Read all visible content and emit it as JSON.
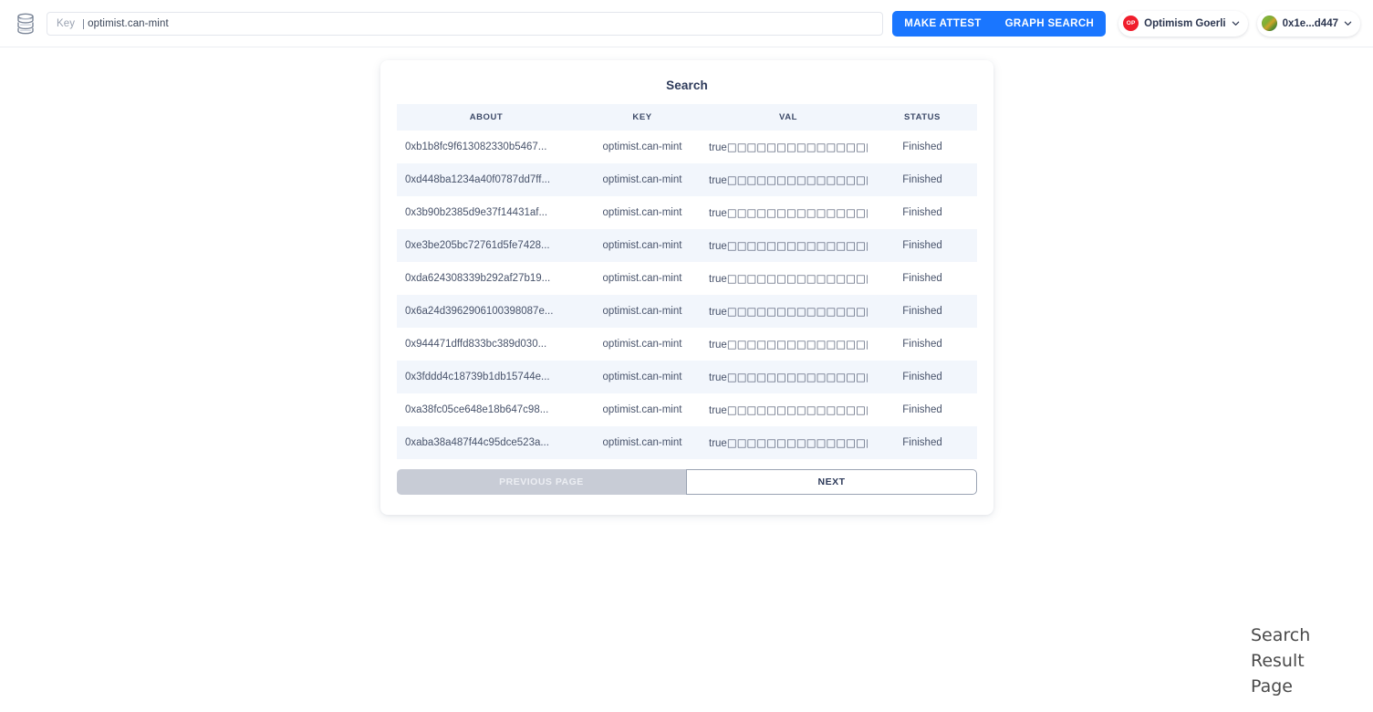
{
  "topbar": {
    "logo_icon": "database-icon",
    "search": {
      "label": "Key",
      "value": "optimist.can-mint",
      "placeholder": "Key"
    },
    "actions": {
      "make_attest": "MAKE ATTEST",
      "graph_search": "GRAPH SEARCH"
    },
    "network": {
      "avatar_text": "OP",
      "label": "Optimism Goerli",
      "chevron_icon": "chevron-down-icon"
    },
    "account": {
      "label": "0x1e...d447",
      "avatar_icon": "blockie-avatar",
      "chevron_icon": "chevron-down-icon"
    },
    "colors": {
      "accent_blue": "#1a76ff",
      "op_red": "#f01e2c"
    }
  },
  "card": {
    "title": "Search",
    "columns": [
      "ABOUT",
      "KEY",
      "VAL",
      "STATUS"
    ],
    "rows": [
      {
        "about": "0xb1b8fc9f613082330b5467...",
        "key": "optimist.can-mint",
        "val_prefix": "true",
        "val_boxes": "□□□□□□□□□□□□□□□□□□",
        "val_suffix": "...",
        "status": "Finished"
      },
      {
        "about": "0xd448ba1234a40f0787dd7ff...",
        "key": "optimist.can-mint",
        "val_prefix": "true",
        "val_boxes": "□□□□□□□□□□□□□□□□□□",
        "val_suffix": "...",
        "status": "Finished"
      },
      {
        "about": "0x3b90b2385d9e37f14431af...",
        "key": "optimist.can-mint",
        "val_prefix": "true",
        "val_boxes": "□□□□□□□□□□□□□□□□□□",
        "val_suffix": "...",
        "status": "Finished"
      },
      {
        "about": "0xe3be205bc72761d5fe7428...",
        "key": "optimist.can-mint",
        "val_prefix": "true",
        "val_boxes": "□□□□□□□□□□□□□□□□□□",
        "val_suffix": "...",
        "status": "Finished"
      },
      {
        "about": "0xda624308339b292af27b19...",
        "key": "optimist.can-mint",
        "val_prefix": "true",
        "val_boxes": "□□□□□□□□□□□□□□□□□□",
        "val_suffix": "...",
        "status": "Finished"
      },
      {
        "about": "0x6a24d3962906100398087e...",
        "key": "optimist.can-mint",
        "val_prefix": "true",
        "val_boxes": "□□□□□□□□□□□□□□□□□□",
        "val_suffix": "...",
        "status": "Finished"
      },
      {
        "about": "0x944471dffd833bc389d030...",
        "key": "optimist.can-mint",
        "val_prefix": "true",
        "val_boxes": "□□□□□□□□□□□□□□□□□□",
        "val_suffix": "...",
        "status": "Finished"
      },
      {
        "about": "0x3fddd4c18739b1db15744e...",
        "key": "optimist.can-mint",
        "val_prefix": "true",
        "val_boxes": "□□□□□□□□□□□□□□□□□□",
        "val_suffix": "...",
        "status": "Finished"
      },
      {
        "about": "0xa38fc05ce648e18b647c98...",
        "key": "optimist.can-mint",
        "val_prefix": "true",
        "val_boxes": "□□□□□□□□□□□□□□□□□□",
        "val_suffix": "...",
        "status": "Finished"
      },
      {
        "about": "0xaba38a487f44c95dce523a...",
        "key": "optimist.can-mint",
        "val_prefix": "true",
        "val_boxes": "□□□□□□□□□□□□□□□□□□",
        "val_suffix": "...",
        "status": "Finished"
      }
    ],
    "pagination": {
      "previous": "PREVIOUS PAGE",
      "next": "NEXT",
      "previous_disabled": true
    }
  },
  "annotation": {
    "line1": "Search",
    "line2": "Result",
    "line3": "Page"
  }
}
